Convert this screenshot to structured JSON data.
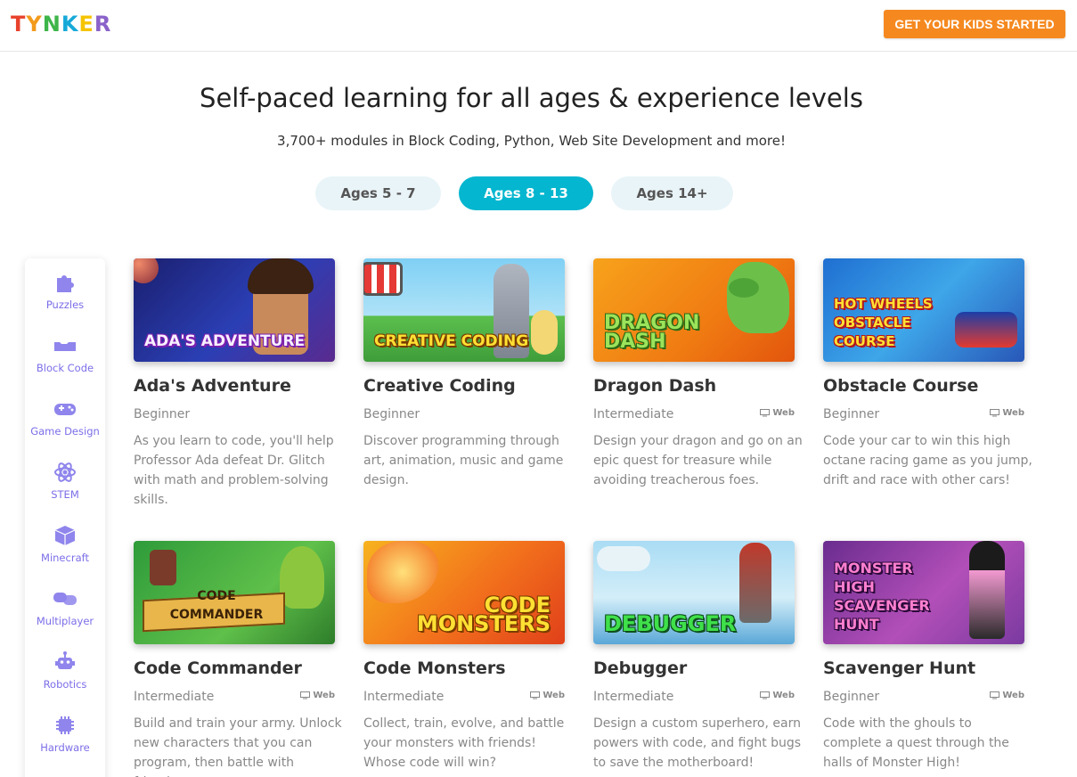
{
  "header": {
    "logo_letters": [
      "T",
      "Y",
      "N",
      "K",
      "E",
      "R"
    ],
    "cta_label": "GET YOUR KIDS STARTED"
  },
  "hero": {
    "title": "Self-paced learning for all ages & experience levels",
    "subtitle": "3,700+ modules in Block Coding, Python, Web Site Development and more!"
  },
  "age_tabs": [
    {
      "label": "Ages 5 - 7",
      "active": false
    },
    {
      "label": "Ages 8 - 13",
      "active": true
    },
    {
      "label": "Ages 14+",
      "active": false
    }
  ],
  "sidebar": {
    "items": [
      {
        "label": "Puzzles",
        "icon": "puzzle-icon"
      },
      {
        "label": "Block Code",
        "icon": "block-code-icon"
      },
      {
        "label": "Game Design",
        "icon": "gamepad-icon"
      },
      {
        "label": "STEM",
        "icon": "atom-icon"
      },
      {
        "label": "Minecraft",
        "icon": "cube-icon"
      },
      {
        "label": "Multiplayer",
        "icon": "multiplayer-icon"
      },
      {
        "label": "Robotics",
        "icon": "robot-icon"
      },
      {
        "label": "Hardware",
        "icon": "chip-icon"
      }
    ]
  },
  "courses": [
    {
      "title": "Ada's Adventure",
      "level": "Beginner",
      "platform": "",
      "art": "ADA's ADVENTURE",
      "desc": "As you learn to code, you'll help Professor Ada defeat Dr. Glitch with math and problem-solving skills."
    },
    {
      "title": "Creative Coding",
      "level": "Beginner",
      "platform": "",
      "art": "CREATIVE CODING",
      "desc": "Discover programming through art, animation, music and game design."
    },
    {
      "title": "Dragon Dash",
      "level": "Intermediate",
      "platform": "Web",
      "art": "DRAGON DASH",
      "desc": "Design your dragon and go on an epic quest for treasure while avoiding treacherous foes."
    },
    {
      "title": "Obstacle Course",
      "level": "Beginner",
      "platform": "Web",
      "art": "HOT WHEELS OBSTACLE COURSE",
      "desc": "Code your car to win this high octane racing game as you jump, drift and race with other cars!"
    },
    {
      "title": "Code Commander",
      "level": "Intermediate",
      "platform": "Web",
      "art": "CODE COMMANDER",
      "desc": "Build and train your army. Unlock new characters that you can program, then battle with friends."
    },
    {
      "title": "Code Monsters",
      "level": "Intermediate",
      "platform": "Web",
      "art": "CODE MONSTERS",
      "desc": "Collect, train, evolve, and battle your monsters with friends! Whose code will win?"
    },
    {
      "title": "Debugger",
      "level": "Intermediate",
      "platform": "Web",
      "art": "DEBUGGER",
      "desc": "Design a custom superhero, earn powers with code, and fight bugs to save the motherboard!"
    },
    {
      "title": "Scavenger Hunt",
      "level": "Beginner",
      "platform": "Web",
      "art": "MONSTER HIGH SCAVENGER HUNT",
      "desc": "Code with the ghouls to complete a quest through the halls of Monster High!"
    }
  ],
  "colors": {
    "accent": "#04b6cf",
    "cta": "#f5891f",
    "sidebar_label": "#7b6ee8"
  }
}
